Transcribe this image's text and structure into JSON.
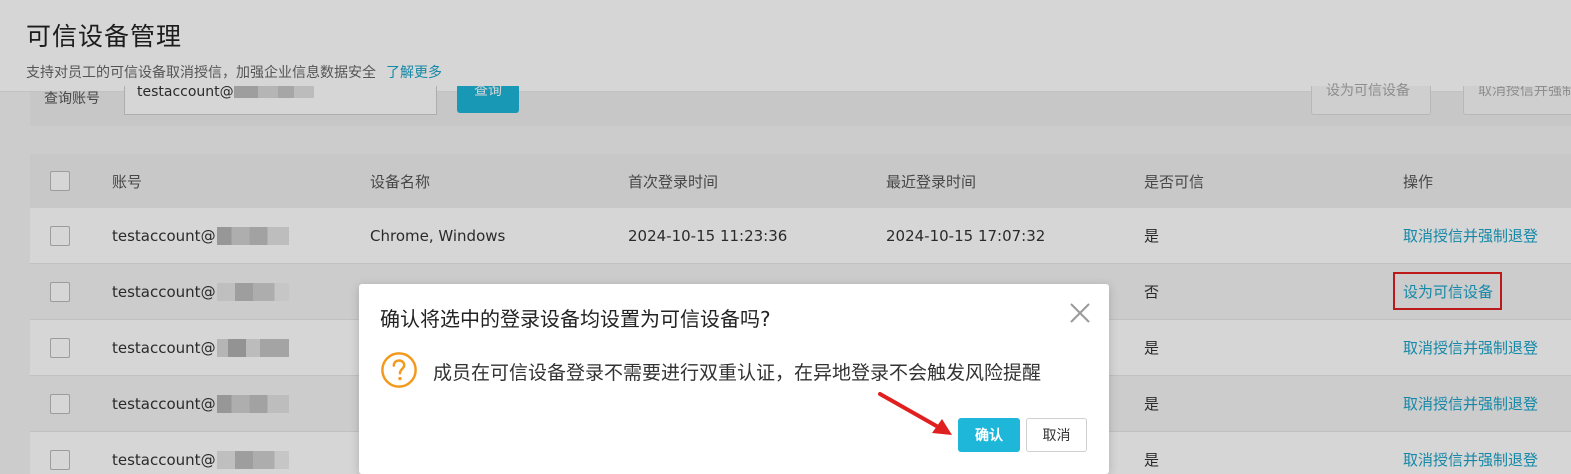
{
  "header": {
    "title": "可信设备管理",
    "subtitle": "支持对员工的可信设备取消授信，加强企业信息数据安全",
    "learn_more": "了解更多"
  },
  "search": {
    "label": "查询账号",
    "value": "testaccount@",
    "query_button": "查询",
    "set_trusted_button": "设为可信设备",
    "revoke_button": "取消授信并强制退登"
  },
  "table": {
    "columns": [
      "账号",
      "设备名称",
      "首次登录时间",
      "最近登录时间",
      "是否可信",
      "操作"
    ],
    "rows": [
      {
        "account": "testaccount@",
        "device": "Chrome, Windows",
        "first_login": "2024-10-15 11:23:36",
        "last_login": "2024-10-15 17:07:32",
        "trusted": "是",
        "action": "取消授信并强制退登"
      },
      {
        "account": "testaccount@",
        "device": "",
        "first_login": "",
        "last_login": "",
        "trusted": "否",
        "action": "设为可信设备"
      },
      {
        "account": "testaccount@",
        "device": "",
        "first_login": "",
        "last_login": "",
        "trusted": "是",
        "action": "取消授信并强制退登"
      },
      {
        "account": "testaccount@",
        "device": "",
        "first_login": "",
        "last_login": "",
        "trusted": "是",
        "action": "取消授信并强制退登"
      },
      {
        "account": "testaccount@",
        "device": "",
        "first_login": "",
        "last_login": "",
        "trusted": "是",
        "action": "取消授信并强制退登"
      }
    ]
  },
  "dialog": {
    "title": "确认将选中的登录设备均设置为可信设备吗?",
    "message": "成员在可信设备登录不需要进行双重认证，在异地登录不会触发风险提醒",
    "confirm": "确认",
    "cancel": "取消"
  },
  "colors": {
    "accent": "#1eb6d9",
    "link": "#1aa3c8",
    "warning": "#f39a1e",
    "highlight": "#e02020"
  },
  "icons": {
    "close": "close-icon",
    "warning": "question-circle-icon",
    "arrow": "red-arrow-icon"
  }
}
